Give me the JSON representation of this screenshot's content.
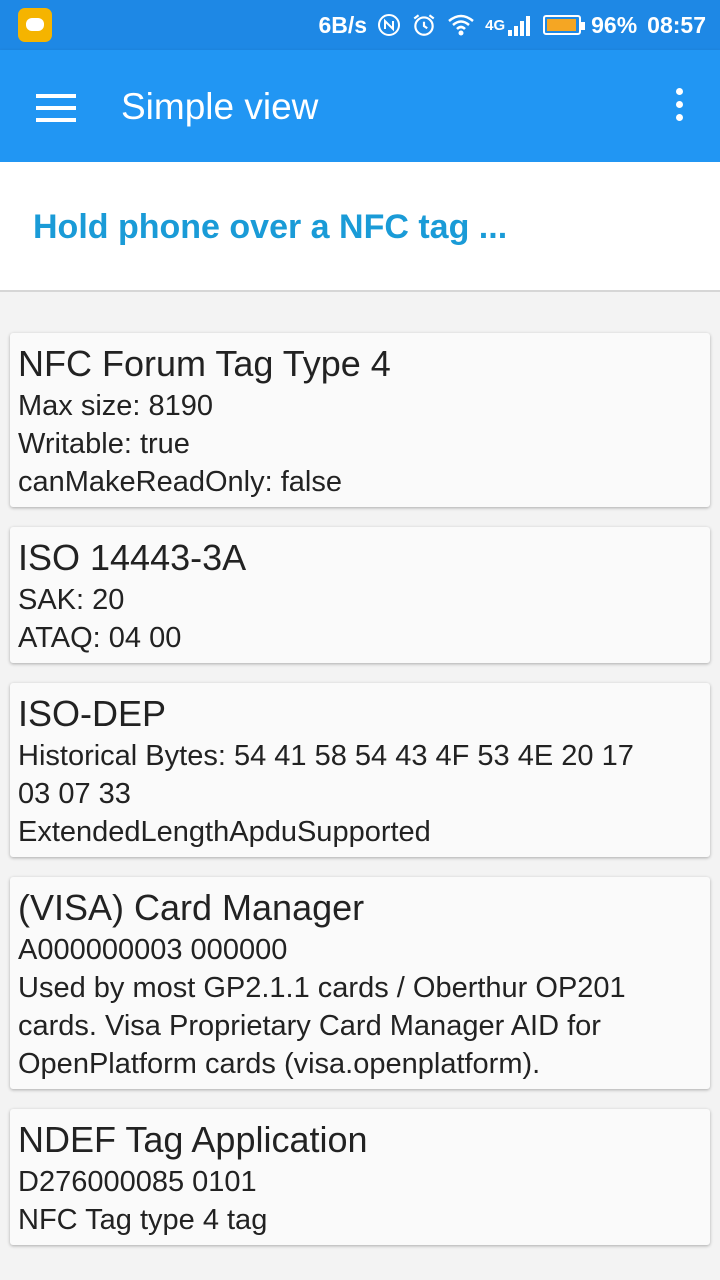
{
  "status_bar": {
    "speed": "6B/s",
    "network": "4G",
    "battery": "96%",
    "time": "08:57",
    "battery_level": 0.96
  },
  "app_bar": {
    "title": "Simple view",
    "menu_icon": "hamburger-menu-icon",
    "overflow_icon": "more-vert-icon"
  },
  "prompt": "Hold phone over a NFC tag ...",
  "cards": [
    {
      "title": "NFC Forum Tag Type 4",
      "lines": [
        "Max size: 8190",
        "Writable: true",
        "canMakeReadOnly: false"
      ]
    },
    {
      "title": "ISO 14443-3A",
      "lines": [
        "SAK: 20",
        "ATAQ: 04 00"
      ]
    },
    {
      "title": "ISO-DEP",
      "lines": [
        "Historical Bytes: 54 41 58 54 43 4F 53 4E 20 17",
        "03 07 33",
        "ExtendedLengthApduSupported"
      ]
    },
    {
      "title": "(VISA) Card Manager",
      "lines": [
        "A000000003 000000",
        "Used by most GP2.1.1 cards / Oberthur OP201",
        "cards. Visa Proprietary Card Manager AID for",
        "OpenPlatform cards (visa.openplatform)."
      ]
    },
    {
      "title": "NDEF Tag Application",
      "lines": [
        "D276000085 0101",
        "NFC Tag type 4 tag"
      ]
    }
  ]
}
